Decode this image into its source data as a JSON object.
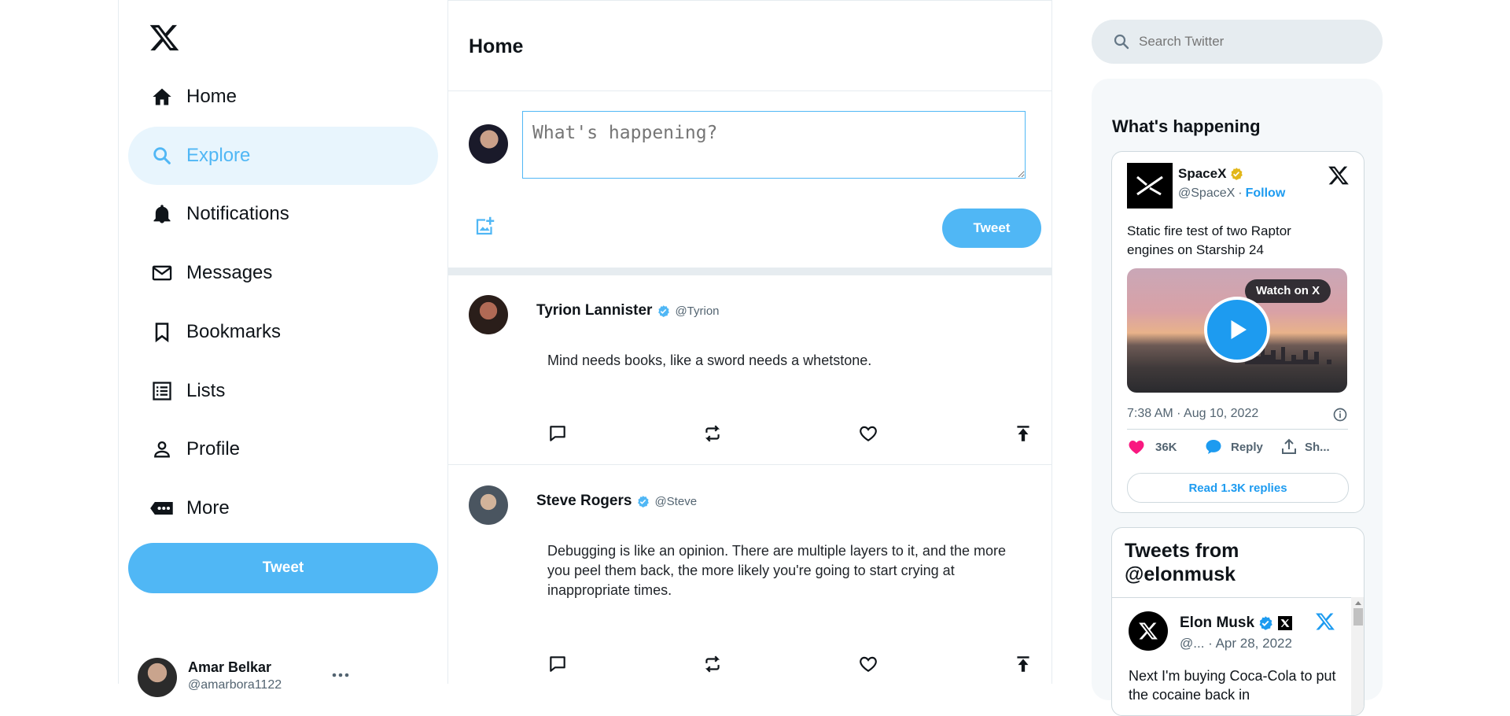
{
  "sidebar": {
    "items": [
      {
        "label": "Home",
        "icon": "home-icon"
      },
      {
        "label": "Explore",
        "icon": "search-icon"
      },
      {
        "label": "Notifications",
        "icon": "bell-icon"
      },
      {
        "label": "Messages",
        "icon": "mail-icon"
      },
      {
        "label": "Bookmarks",
        "icon": "bookmark-icon"
      },
      {
        "label": "Lists",
        "icon": "list-icon"
      },
      {
        "label": "Profile",
        "icon": "person-icon"
      },
      {
        "label": "More",
        "icon": "more-icon"
      }
    ],
    "tweet_label": "Tweet",
    "user": {
      "name": "Amar Belkar",
      "handle": "@amarbora1122"
    },
    "accent": "#50b7f5"
  },
  "feed": {
    "title": "Home",
    "compose": {
      "placeholder": "What's happening?",
      "tweet_label": "Tweet"
    },
    "posts": [
      {
        "name": "Tyrion Lannister",
        "handle": "@Tyrion",
        "text": "Mind needs books, like a sword needs a whetstone."
      },
      {
        "name": "Steve Rogers",
        "handle": "@Steve",
        "text": "Debugging is like an opinion. There are multiple layers to it, and the more you peel them back, the more likely you're going to start crying at inappropriate times."
      }
    ]
  },
  "right": {
    "search_placeholder": "Search Twitter",
    "widget_title": "What's happening",
    "embed": {
      "account_name": "SpaceX",
      "handle": "@SpaceX",
      "separator": "·",
      "follow": "Follow",
      "text": "Static fire test of two Raptor engines on Starship 24",
      "watch_label": "Watch on X",
      "timestamp": "7:38 AM · Aug 10, 2022",
      "likes": "36K",
      "reply": "Reply",
      "share": "Sh...",
      "read_replies": "Read 1.3K replies"
    },
    "timeline": {
      "title": "Tweets from @elonmusk",
      "name": "Elon Musk",
      "meta": "@... · Apr 28, 2022",
      "text": "Next I'm buying Coca-Cola to put the cocaine back in"
    }
  }
}
